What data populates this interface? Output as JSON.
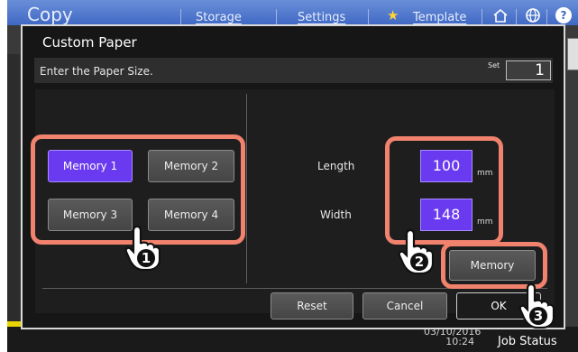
{
  "background": {
    "app_title": "Copy",
    "tabs": [
      "Storage",
      "Settings",
      "Template"
    ],
    "datetime": [
      "03/10/2016",
      "10:24"
    ],
    "job_status": "Job Status"
  },
  "dialog": {
    "title": "Custom Paper",
    "instruction": "Enter the Paper Size.",
    "set_label": "Set",
    "set_value": "1",
    "memory_buttons": [
      "Memory 1",
      "Memory 2",
      "Memory 3",
      "Memory 4"
    ],
    "length_label": "Length",
    "length_value": "100",
    "width_label": "Width",
    "width_value": "148",
    "unit": "mm",
    "memory_button": "Memory",
    "reset_button": "Reset",
    "cancel_button": "Cancel",
    "ok_button": "OK"
  },
  "callouts": [
    "1",
    "2",
    "3"
  ],
  "colors": {
    "accent": "#6a3af0",
    "callout": "#f0826e",
    "title_bar": "#4a74cc"
  }
}
